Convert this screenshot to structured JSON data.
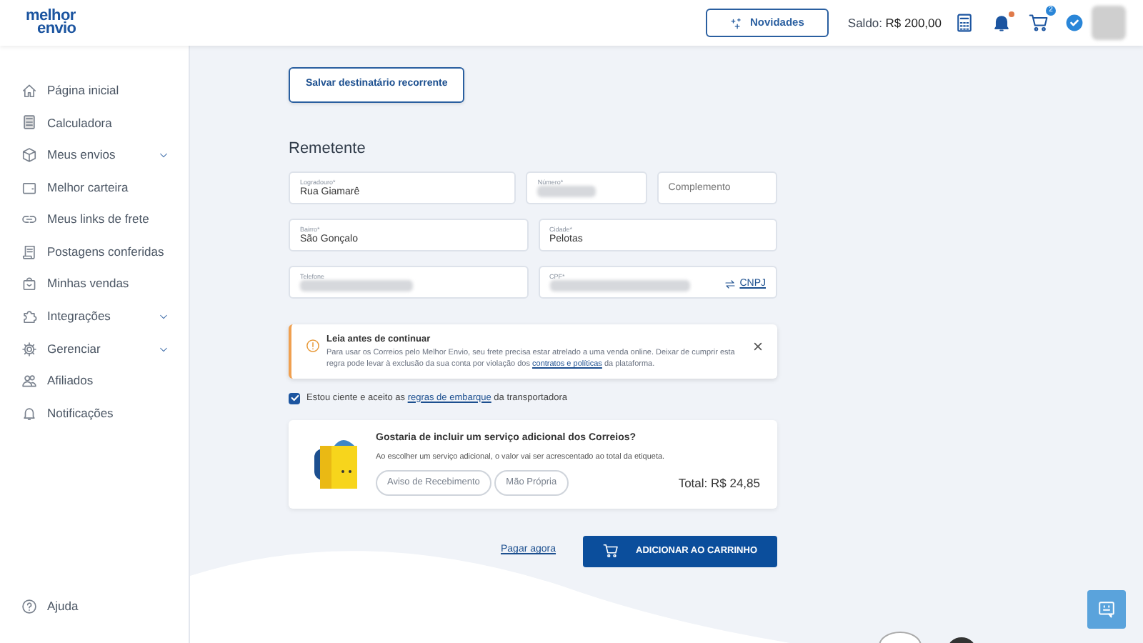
{
  "header": {
    "logo": [
      "melhor",
      "envio"
    ],
    "news_button": "Novidades",
    "balance_label": "Saldo:",
    "balance_value": "R$ 200,00",
    "notification_dot": true,
    "cart_count": "2"
  },
  "sidebar": {
    "items": [
      {
        "label": "Página inicial",
        "expandable": false
      },
      {
        "label": "Calculadora",
        "expandable": false
      },
      {
        "label": "Meus envios",
        "expandable": true
      },
      {
        "label": "Melhor carteira",
        "expandable": false
      },
      {
        "label": "Meus links de frete",
        "expandable": false
      },
      {
        "label": "Postagens conferidas",
        "expandable": false
      },
      {
        "label": "Minhas vendas",
        "expandable": false
      },
      {
        "label": "Integrações",
        "expandable": true
      },
      {
        "label": "Gerenciar",
        "expandable": true
      },
      {
        "label": "Afiliados",
        "expandable": false
      },
      {
        "label": "Notificações",
        "expandable": false
      }
    ],
    "help": "Ajuda"
  },
  "save_recipient_button": "Salvar destinatário recorrente",
  "section_title": "Remetente",
  "field_rows": [
    [
      {
        "label": "Logradouro*",
        "value": "Rua Giamarê",
        "redacted": false
      },
      {
        "label": "Número*",
        "redacted": true
      },
      {
        "placeholder": "Complemento",
        "redacted": false
      }
    ],
    [
      {
        "label": "Bairro*",
        "value": "São Gonçalo",
        "redacted": false
      },
      {
        "label": "Cidade*",
        "value": "Pelotas",
        "redacted": false
      }
    ],
    [
      {
        "label": "Telefone",
        "redacted": true
      },
      {
        "label": "CPF*",
        "redacted": true,
        "toggle": "CNPJ"
      }
    ]
  ],
  "alert": {
    "title": "Leia antes de continuar",
    "text_before": "Para usar os Correios pelo Melhor Envio, seu frete precisa estar atrelado a uma venda online. Deixar de cumprir esta regra pode levar à exclusão da sua conta por violação dos",
    "link": "contratos e políticas",
    "text_after": "da plataforma."
  },
  "terms": {
    "checked": true,
    "text_before": "Estou ciente e aceito as",
    "link": "regras de embarque",
    "text_after": "da transportadora"
  },
  "addon": {
    "title": "Gostaria de incluir um serviço adicional dos Correios?",
    "description": "Ao escolher um serviço adicional, o valor vai ser acrescentado ao total da etiqueta.",
    "options": [
      {
        "label": "Aviso de Recebimento",
        "selected": false
      },
      {
        "label": "Mão Própria",
        "selected": false
      }
    ],
    "total": "Total: R$ 24,85"
  },
  "actions": {
    "pay_link": "Pagar agora",
    "add_to_cart": "ADICIONAR AO CARRINHO"
  }
}
